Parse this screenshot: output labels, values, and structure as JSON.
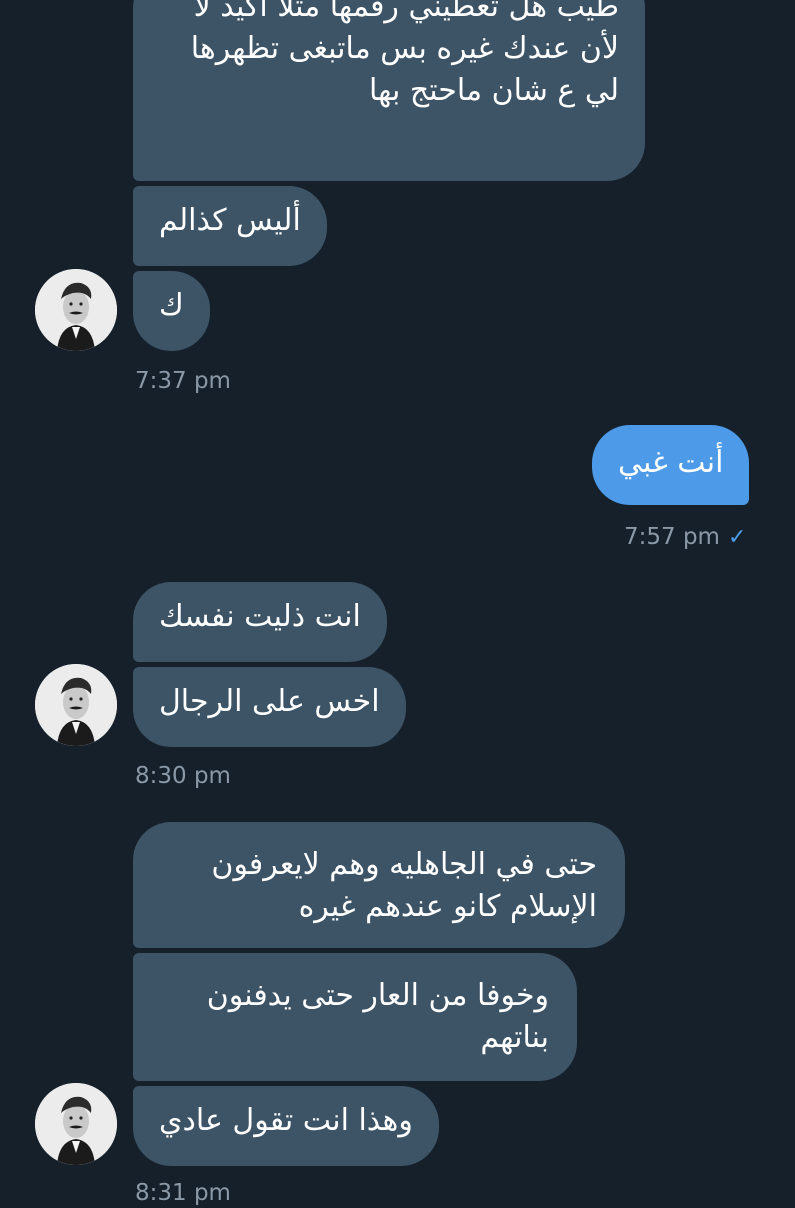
{
  "conversation": {
    "messages": [
      {
        "id": "m1",
        "from": "other",
        "text": "طيب هل تعطيني رقمها مثلا اكيد لا لأن عندك غيره بس ماتبغى تظهرها لي ع شان ماحتج بها"
      },
      {
        "id": "m2",
        "from": "other",
        "text": "أليس كذالم"
      },
      {
        "id": "m3",
        "from": "other",
        "text": "ك"
      },
      {
        "id": "t1",
        "type": "timestamp",
        "text": "7:37 pm"
      },
      {
        "id": "m4",
        "from": "me",
        "text": "أنت غبي"
      },
      {
        "id": "t2",
        "type": "timestamp",
        "text": "7:57 pm",
        "status": "sent"
      },
      {
        "id": "m5",
        "from": "other",
        "text": "انت ذليت نفسك"
      },
      {
        "id": "m6",
        "from": "other",
        "text": "اخس على الرجال"
      },
      {
        "id": "t3",
        "type": "timestamp",
        "text": "8:30 pm"
      },
      {
        "id": "m7",
        "from": "other",
        "text": "حتى في الجاهليه وهم لايعرفون الإسلام كانو عندهم غيره"
      },
      {
        "id": "m8",
        "from": "other",
        "text": "وخوفا من العار حتى يدفنون بناتهم"
      },
      {
        "id": "m9",
        "from": "other",
        "text": "وهذا انت تقول عادي"
      },
      {
        "id": "t4",
        "type": "timestamp",
        "text": "8:31 pm"
      }
    ],
    "checkmark_icon": "checkmark-icon",
    "avatar_icon": "user-avatar",
    "colors": {
      "background": "#15202b",
      "received_bubble": "#3d5466",
      "sent_bubble": "#4c9ae8",
      "timestamp": "#8b98a5",
      "checkmark": "#4c9ae8"
    }
  }
}
